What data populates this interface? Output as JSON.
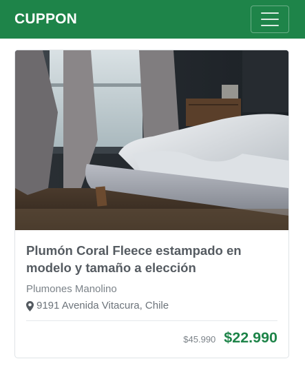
{
  "navbar": {
    "brand": "CUPPON",
    "menu_icon": "hamburger-menu-icon"
  },
  "deal": {
    "image_alt": "Cama con plumón blanco junto a una ventana",
    "title": "Plumón Coral Fleece estampado en modelo y tamaño a elección",
    "seller": "Plumones Manolino",
    "address_icon": "map-marker-icon",
    "address": "9191 Avenida Vitacura, Chile",
    "old_price": "$45.990",
    "new_price": "$22.990"
  },
  "colors": {
    "brand_green": "#1e8449",
    "text_gray": "#555b61"
  }
}
